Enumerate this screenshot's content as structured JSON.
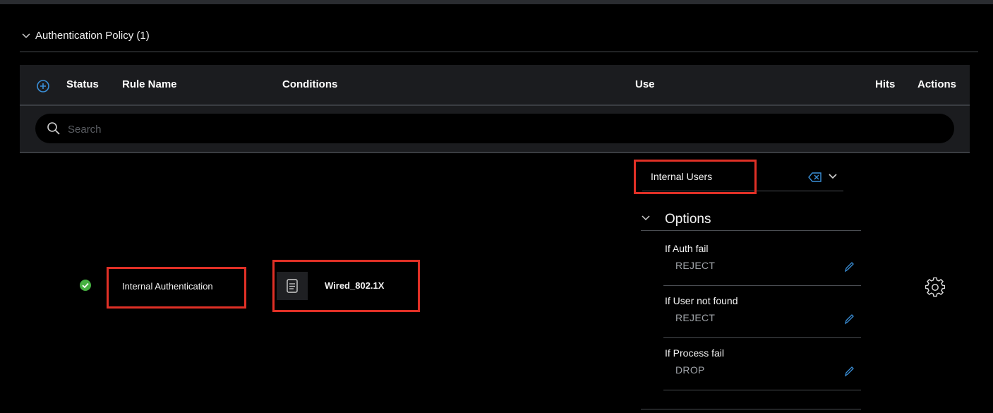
{
  "section": {
    "title": "Authentication Policy (1)"
  },
  "table": {
    "headers": {
      "status": "Status",
      "rule_name": "Rule Name",
      "conditions": "Conditions",
      "use": "Use",
      "hits": "Hits",
      "actions": "Actions"
    }
  },
  "search": {
    "placeholder": "Search",
    "value": ""
  },
  "rule": {
    "name": "Internal Authentication",
    "condition": "Wired_802.1X",
    "use": "Internal Users",
    "options_title": "Options",
    "options": [
      {
        "label": "If Auth fail",
        "value": "REJECT"
      },
      {
        "label": "If User not found",
        "value": "REJECT"
      },
      {
        "label": "If Process fail",
        "value": "DROP"
      }
    ]
  },
  "colors": {
    "accent": "#3a8fd8",
    "status_ok": "#45b040",
    "highlight": "#e03026",
    "header_bg": "#1b1c1f"
  },
  "icons": {
    "collapse": "chevron-down-icon",
    "add": "plus-circle-icon",
    "search": "search-icon",
    "status": "check-circle-icon",
    "condition": "document-icon",
    "clear": "clear-icon",
    "edit": "pencil-icon",
    "actions": "gear-icon"
  }
}
